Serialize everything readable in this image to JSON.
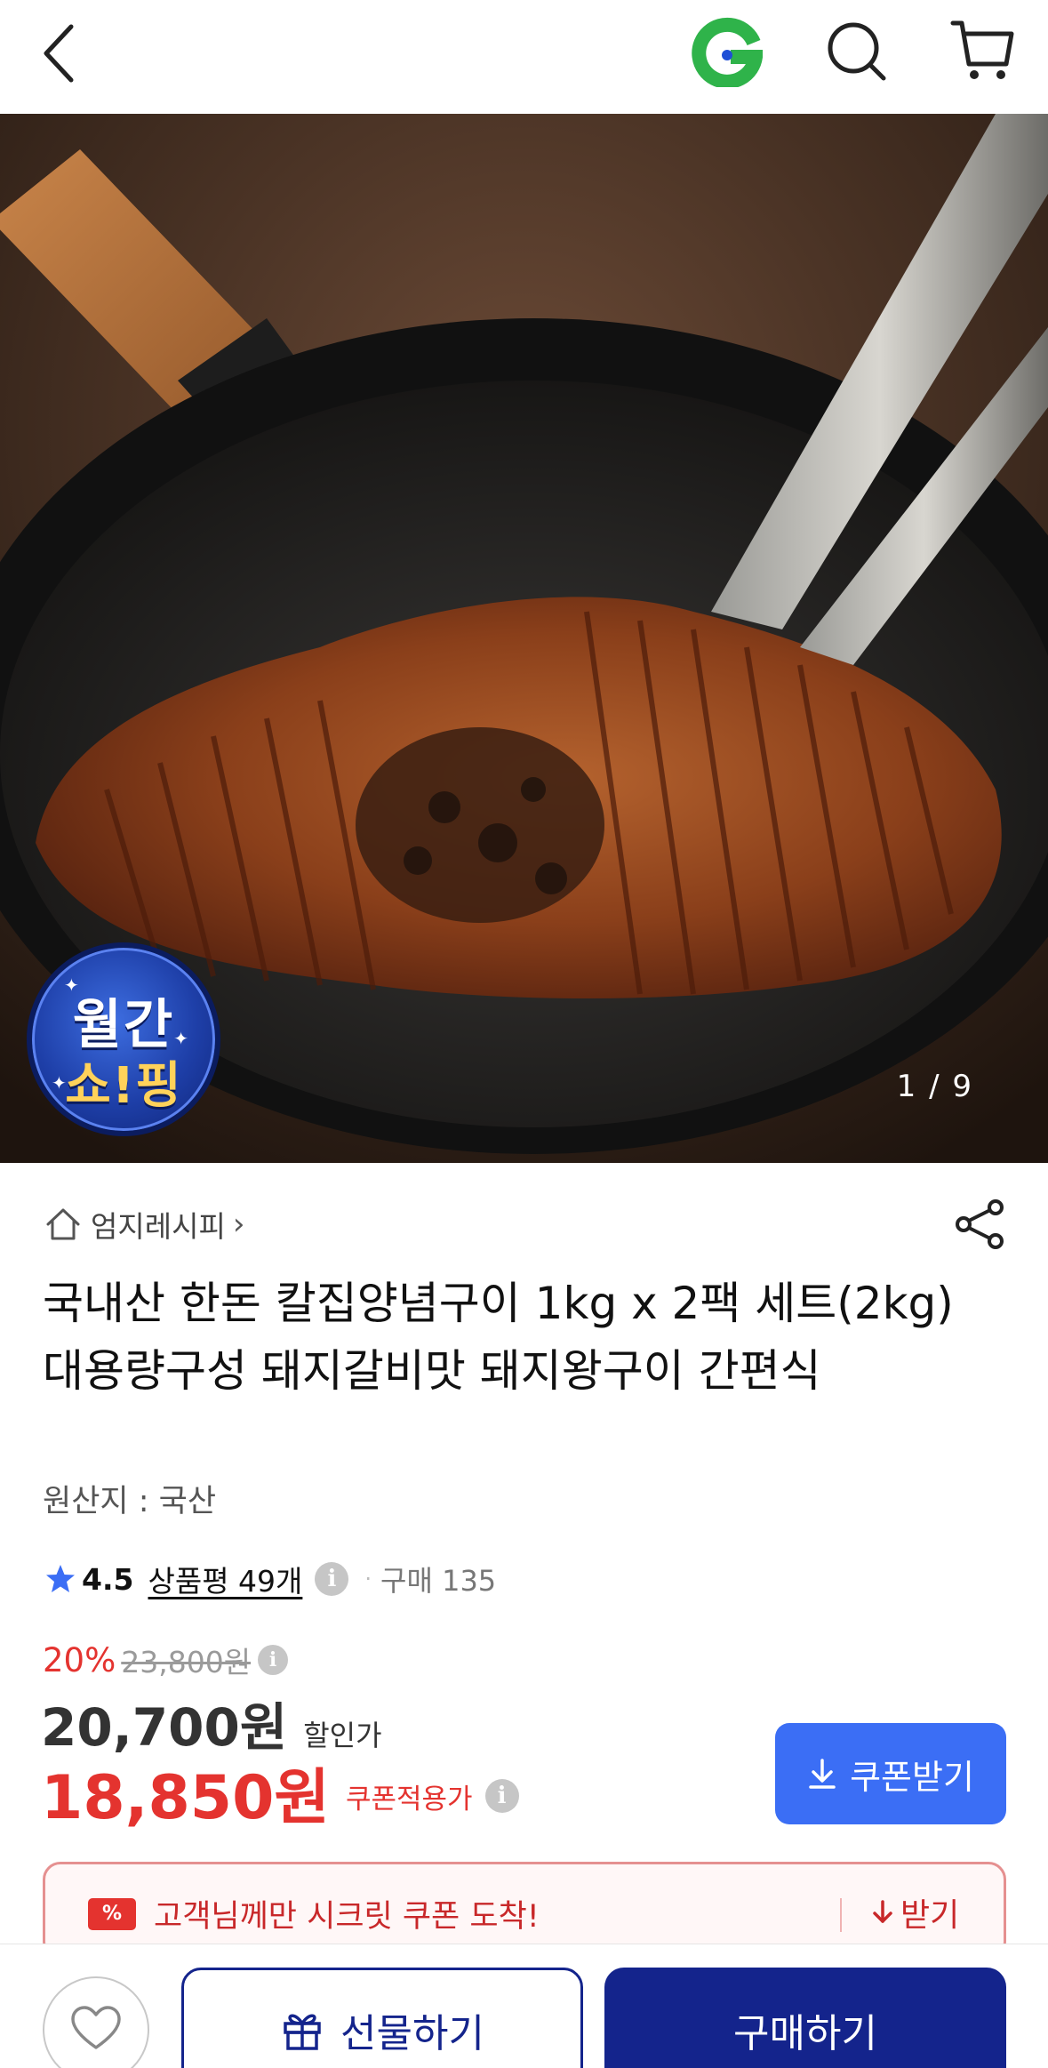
{
  "header": {
    "back_icon": "chevron-left-icon",
    "logo_icon": "gmarket-g-logo",
    "search_icon": "search-icon",
    "cart_icon": "cart-icon"
  },
  "hero": {
    "badge_top": "월간",
    "badge_bottom": "쇼!핑",
    "page_indicator": "1 / 9"
  },
  "product": {
    "store_name": "엄지레시피",
    "store_chevron": "›",
    "title": "국내산 한돈 칼집양념구이 1kg x 2팩 세트(2kg) 대용량구성 돼지갈비맛 돼지왕구이 간편식",
    "origin": "원산지 : 국산"
  },
  "rating": {
    "score": "4.5",
    "reviews": "상품평 49개",
    "purchases": "구매 135"
  },
  "price": {
    "discount_rate": "20%",
    "original": "23,800원",
    "sale": "20,700원",
    "sale_label": "할인가",
    "coupon_price": "18,850원",
    "coupon_label": "쿠폰적용가",
    "coupon_button": "쿠폰받기"
  },
  "secret_coupon": {
    "icon_text": "%",
    "text": "고객님께만 시크릿 쿠폰 도착!",
    "receive": "받기"
  },
  "bottom_bar": {
    "gift": "선물하기",
    "buy": "구매하기"
  },
  "colors": {
    "accent_red": "#e4332f",
    "coupon_blue": "#3b6ef5",
    "navy": "#14248c",
    "gmarket_green": "#2fb34a"
  }
}
